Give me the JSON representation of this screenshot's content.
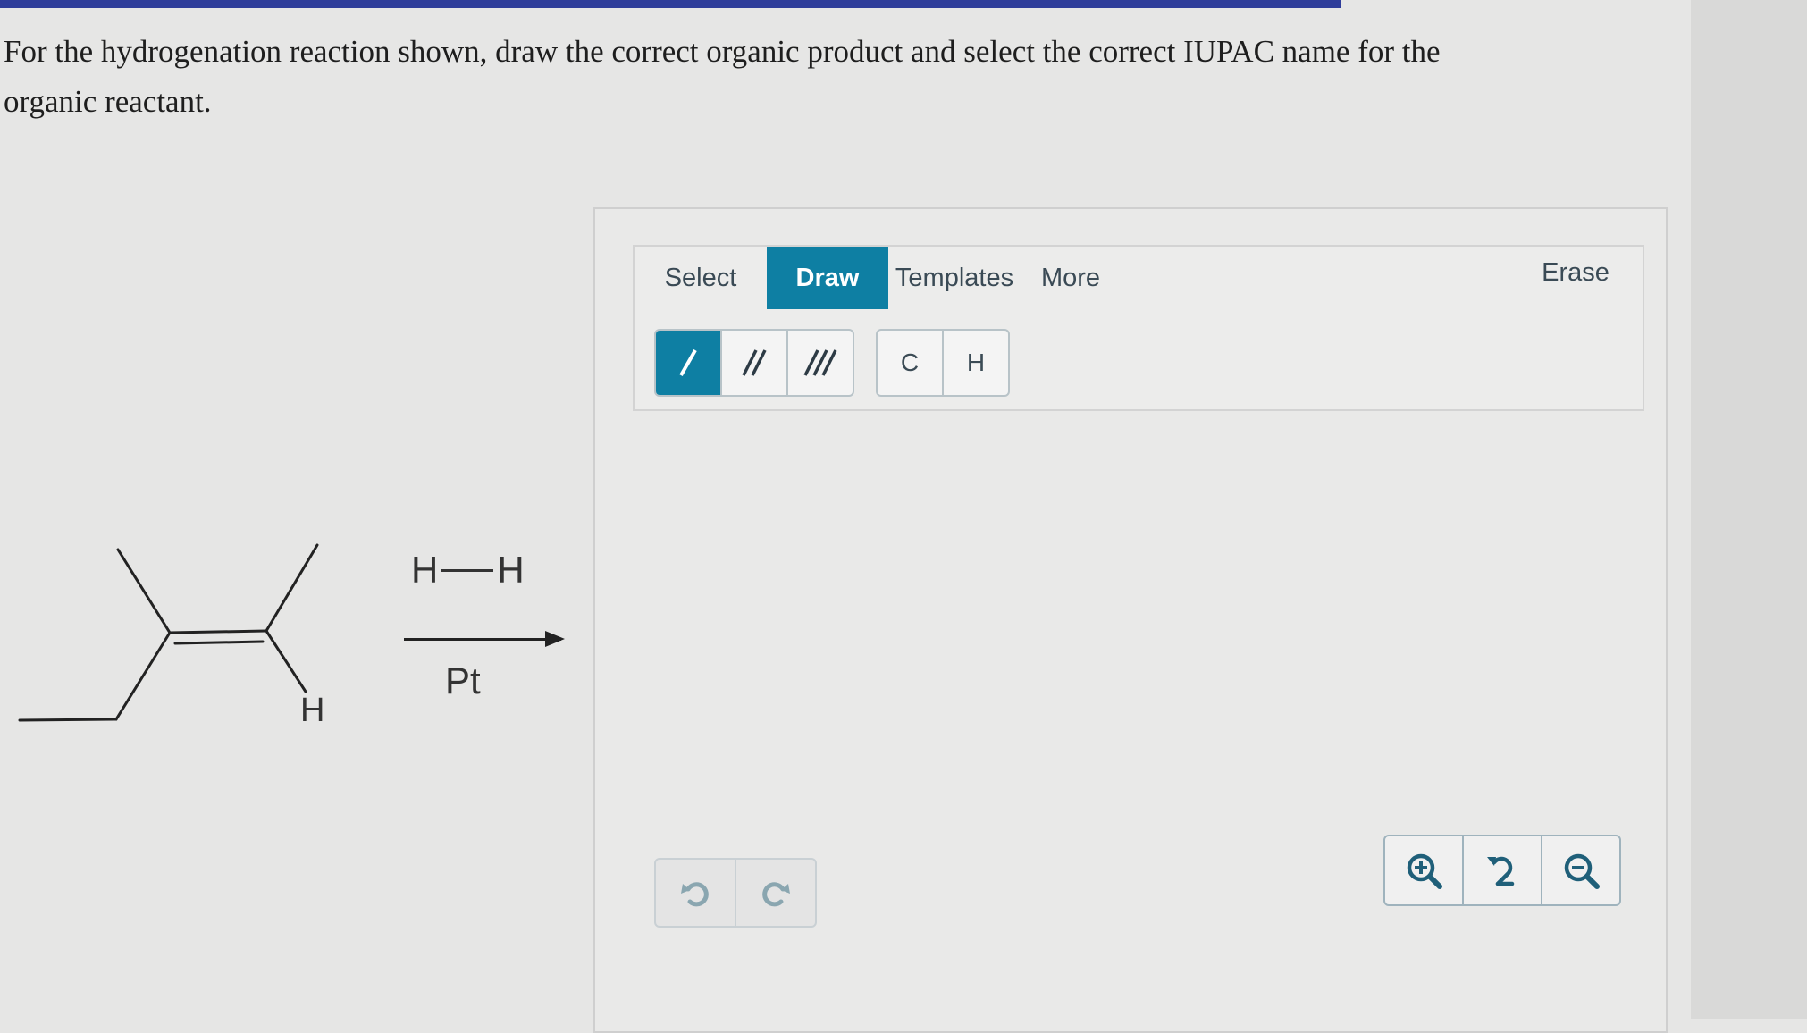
{
  "question": {
    "text": "For the hydrogenation reaction shown, draw the correct organic product and select the correct IUPAC name for the organic reactant."
  },
  "reaction": {
    "hydrogen_label": "H",
    "reagent_left": "H",
    "reagent_right": "H",
    "catalyst": "Pt"
  },
  "editor": {
    "tabs": [
      "Select",
      "Draw",
      "Templates",
      "More"
    ],
    "active_tab": "Draw",
    "erase_label": "Erase",
    "bond_tools": [
      "single-bond",
      "double-bond",
      "triple-bond"
    ],
    "active_tool": "single-bond",
    "atom_tools": [
      "C",
      "H"
    ],
    "history_tools": [
      "undo",
      "redo"
    ],
    "zoom_tools": [
      "zoom-in",
      "reset-zoom",
      "zoom-out"
    ]
  },
  "colors": {
    "accent": "#0e7fa3",
    "top_bar": "#2f3d9a"
  }
}
